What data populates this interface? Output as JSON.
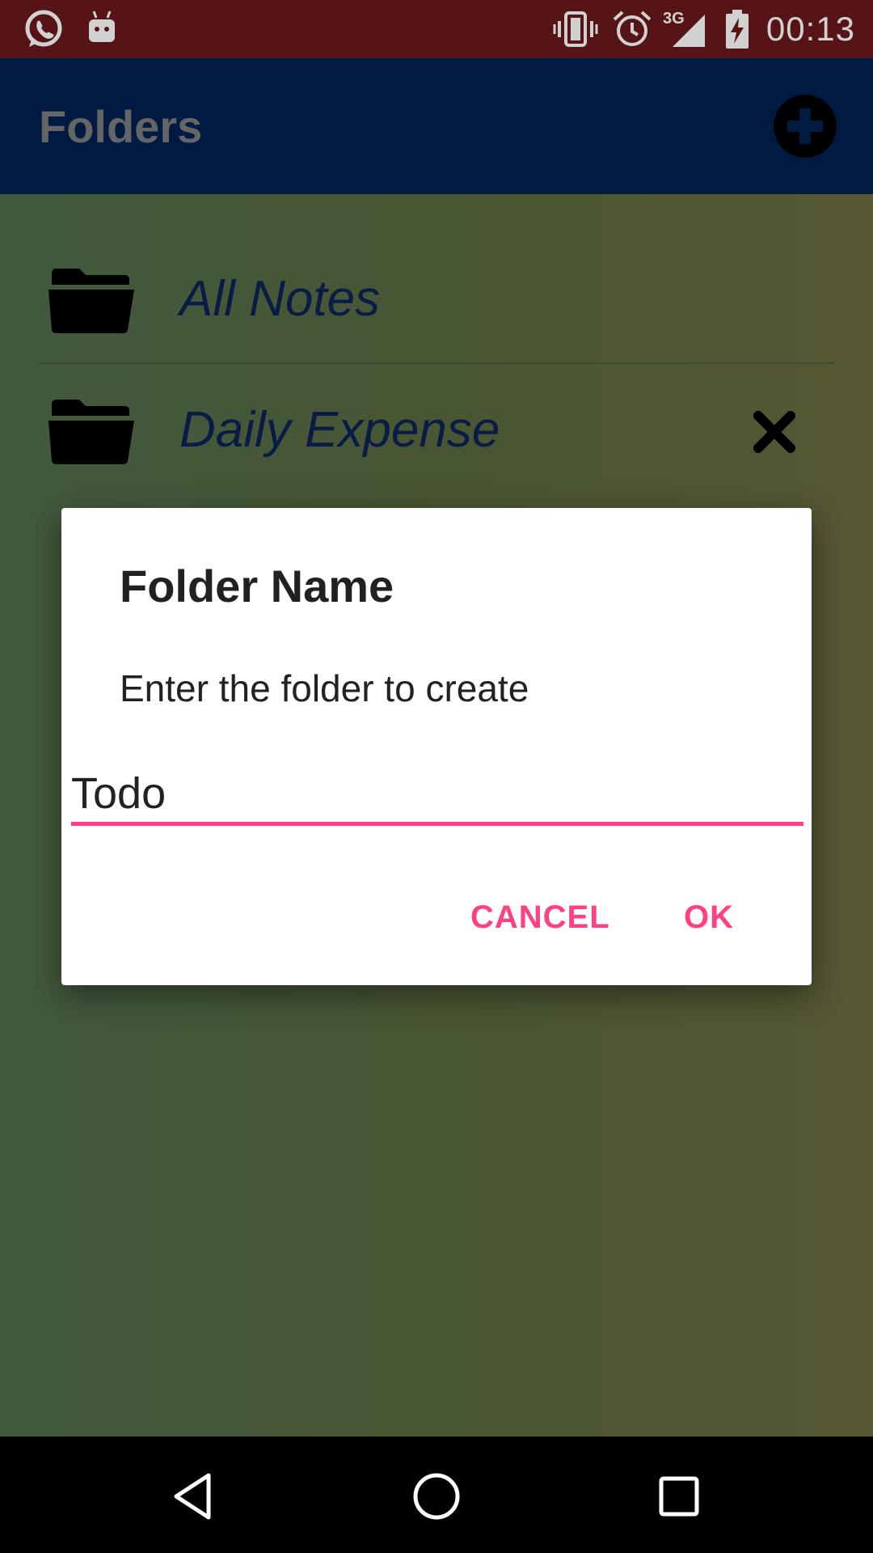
{
  "status_bar": {
    "time": "00:13",
    "network_label": "3G",
    "icons": [
      "whatsapp-icon",
      "android-icon",
      "vibrate-icon",
      "alarm-icon",
      "signal-icon",
      "battery-charging-icon"
    ]
  },
  "appbar": {
    "title": "Folders",
    "add_icon": "add-circle-icon"
  },
  "folders": [
    {
      "label": "All Notes",
      "icon": "folder-open-icon"
    },
    {
      "label": "Daily Expense",
      "icon": "folder-open-icon",
      "delete_icon": "close-icon"
    }
  ],
  "dialog": {
    "title": "Folder Name",
    "message": "Enter the folder to create",
    "input_value": "Todo",
    "cancel_label": "CANCEL",
    "ok_label": "OK",
    "accent_color": "#ff4081"
  },
  "navbar": {
    "icons": [
      "back-icon",
      "home-icon",
      "recents-icon"
    ]
  },
  "colors": {
    "status_bar": "#6a191d",
    "app_bar": "#002051",
    "folder_text": "#0c2356"
  }
}
